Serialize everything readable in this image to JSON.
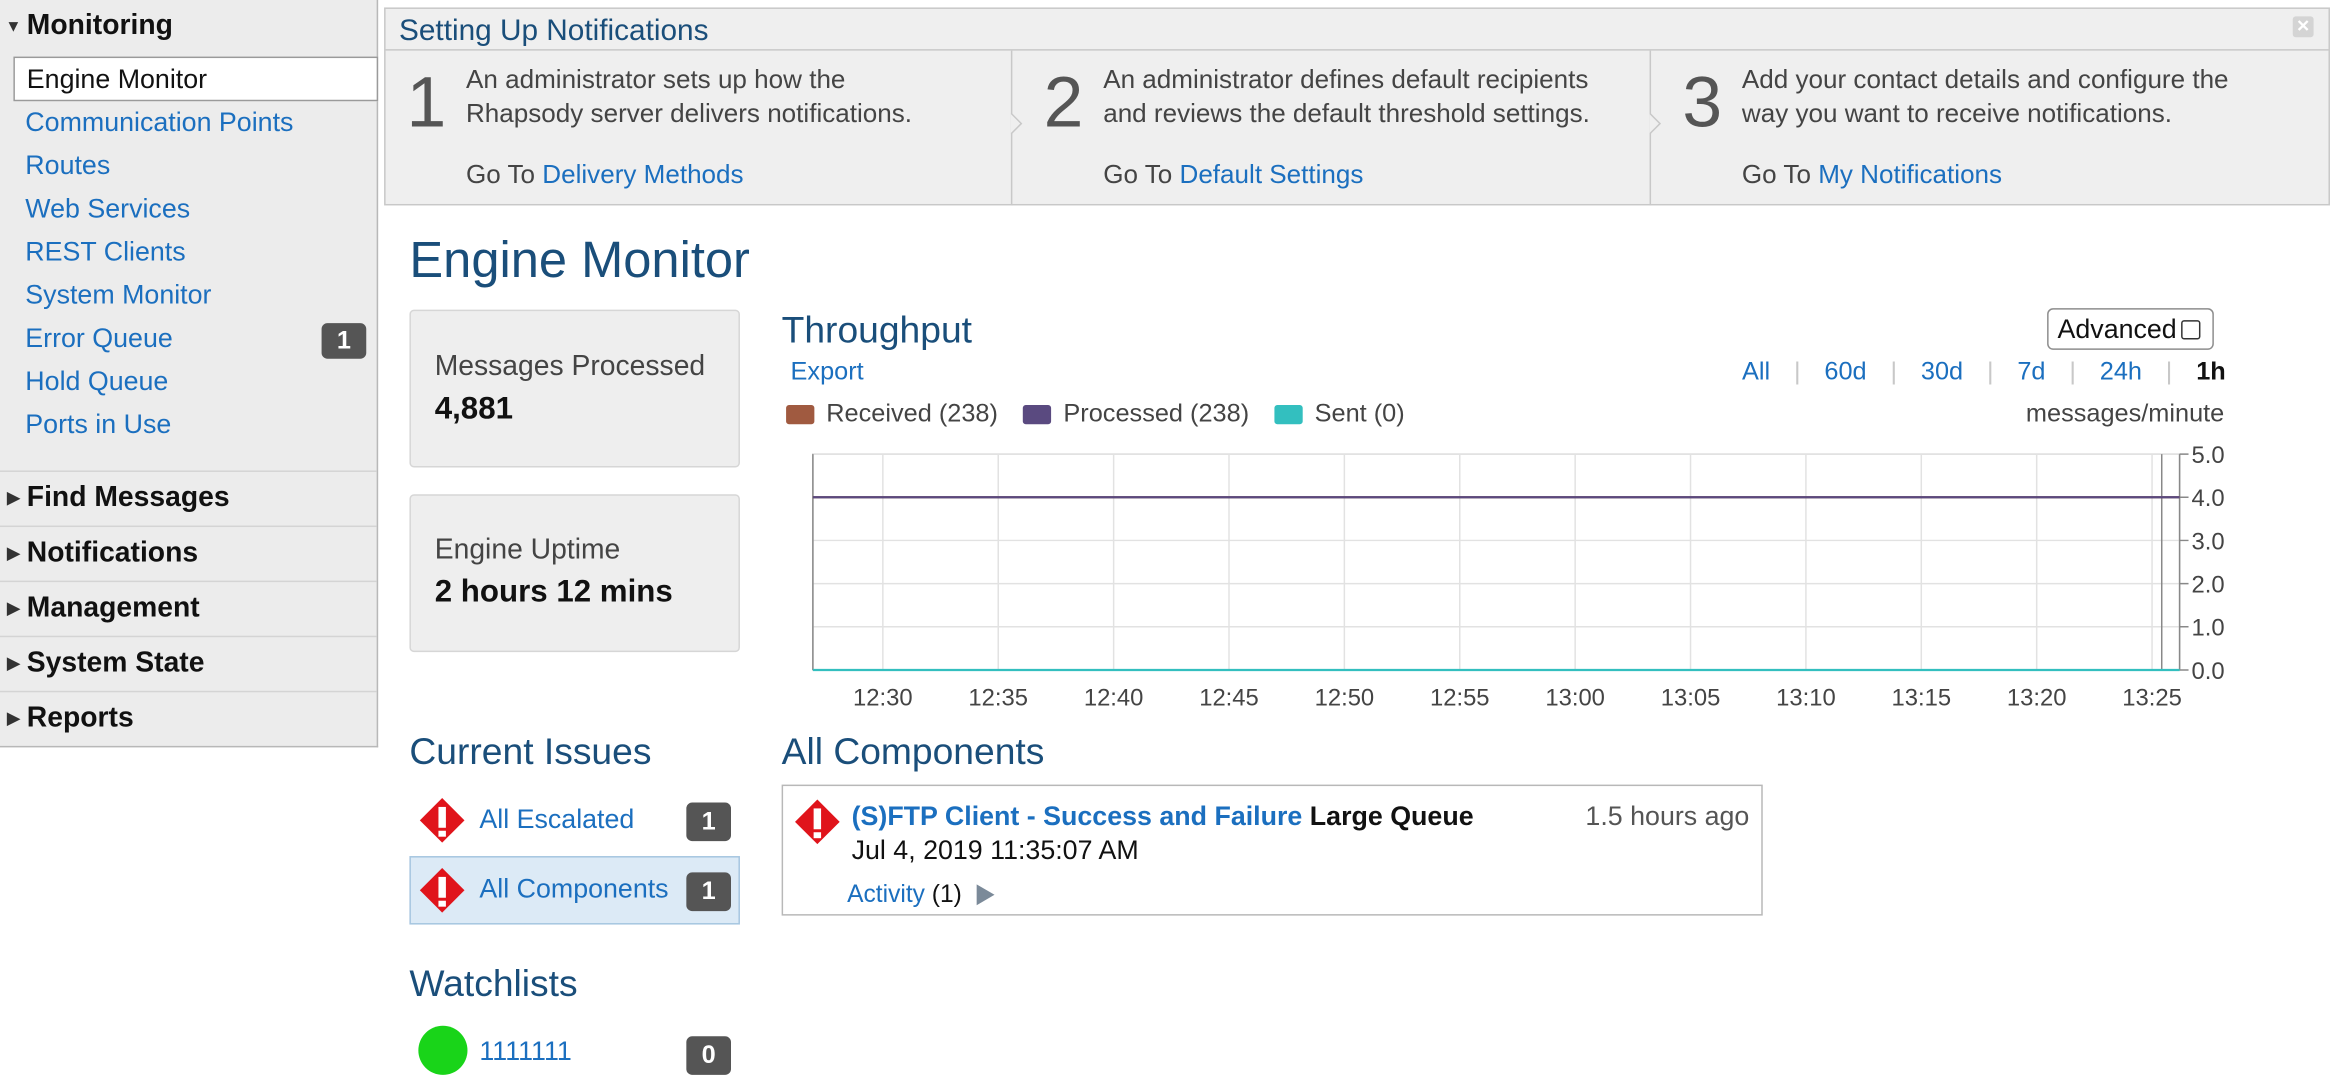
{
  "sidebar": {
    "monitoring": "Monitoring",
    "selected": "Engine Monitor",
    "items": [
      {
        "label": "Communication Points"
      },
      {
        "label": "Routes"
      },
      {
        "label": "Web Services"
      },
      {
        "label": "REST Clients"
      },
      {
        "label": "System Monitor"
      },
      {
        "label": "Error Queue",
        "badge": "1"
      },
      {
        "label": "Hold Queue"
      },
      {
        "label": "Ports in Use"
      }
    ],
    "sections": [
      "Find Messages",
      "Notifications",
      "Management",
      "System State",
      "Reports"
    ]
  },
  "banner": {
    "title": "Setting Up Notifications",
    "close": "✕",
    "go_to": "Go To",
    "steps": [
      {
        "num": "1",
        "line1": "An administrator sets up how the",
        "line2": "Rhapsody server delivers notifications.",
        "link": "Delivery Methods"
      },
      {
        "num": "2",
        "line1": "An administrator defines default recipients",
        "line2": "and reviews the default threshold settings.",
        "link": "Default Settings"
      },
      {
        "num": "3",
        "line1": "Add your contact details and configure the",
        "line2": "way you want to receive notifications.",
        "link": "My Notifications"
      }
    ]
  },
  "page_title": "Engine Monitor",
  "stats": {
    "messages_label": "Messages Processed",
    "messages_value": "4,881",
    "uptime_label": "Engine Uptime",
    "uptime_value": "2 hours 12 mins"
  },
  "issues": {
    "heading": "Current Issues",
    "rows": [
      {
        "label": "All Escalated",
        "count": "1"
      },
      {
        "label": "All Components",
        "count": "1"
      }
    ]
  },
  "watchlists": {
    "heading": "Watchlists",
    "name": "1111111",
    "count": "0"
  },
  "throughput": {
    "title": "Throughput",
    "export": "Export",
    "advanced": "Advanced",
    "ranges": [
      "All",
      "60d",
      "30d",
      "7d",
      "24h",
      "1h"
    ],
    "active_range": "1h",
    "unit": "messages/minute"
  },
  "chart_data": {
    "type": "line",
    "title": "Throughput",
    "x": [
      "12:30",
      "12:35",
      "12:40",
      "12:45",
      "12:50",
      "12:55",
      "13:00",
      "13:05",
      "13:10",
      "13:15",
      "13:20",
      "13:25"
    ],
    "ylabel": "messages/minute",
    "yticks": [
      "5.0",
      "4.0",
      "3.0",
      "2.0",
      "1.0",
      "0.0"
    ],
    "ylim": [
      0,
      5
    ],
    "grid": true,
    "series": [
      {
        "name": "Received (238)",
        "color": "#a05a40",
        "value": 4.0
      },
      {
        "name": "Processed (238)",
        "color": "#5a4a80",
        "value": 4.0
      },
      {
        "name": "Sent (0)",
        "color": "#33bfbf",
        "value": 0.0
      }
    ]
  },
  "components": {
    "heading": "All Components",
    "item": {
      "name": "(S)FTP Client - Success and Failure",
      "status": "Large Queue",
      "age": "1.5 hours ago",
      "date": "Jul 4, 2019 11:35:07 AM",
      "activity_label": "Activity",
      "activity_count": "(1)"
    }
  },
  "colors": {
    "accent": "#1b6fbf",
    "heading": "#1a4e7a",
    "warn": "#e0141b",
    "watch_ok": "#19d419"
  }
}
